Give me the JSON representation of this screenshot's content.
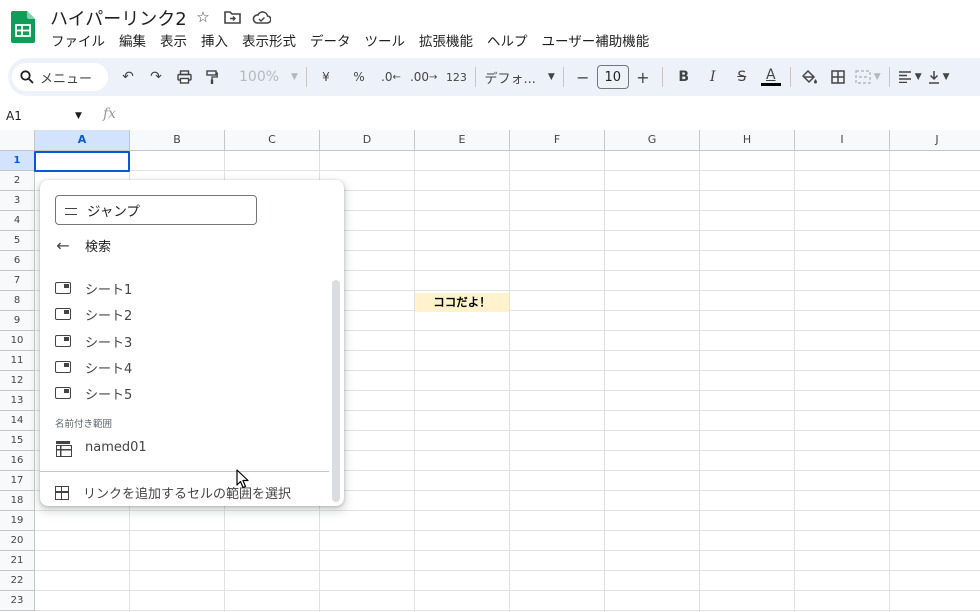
{
  "app": {
    "title": "ハイパーリンク2",
    "brand_color": "#0f9d58"
  },
  "menu": [
    "ファイル",
    "編集",
    "表示",
    "挿入",
    "表示形式",
    "データ",
    "ツール",
    "拡張機能",
    "ヘルプ",
    "ユーザー補助機能"
  ],
  "toolbar": {
    "menu_search": "メニュー",
    "zoom": "100%",
    "currency": "¥",
    "percent": "%",
    "dec_decrease": ".0",
    "dec_increase": ".00",
    "number_format": "123",
    "font": "デフォ...",
    "font_size": "10",
    "minus": "−",
    "plus": "+",
    "bold": "B",
    "italic": "I",
    "strike": "S",
    "text_color": "A"
  },
  "formula_bar": {
    "cell_ref": "A1",
    "fx": "fx"
  },
  "grid": {
    "columns": [
      "A",
      "B",
      "C",
      "D",
      "E",
      "F",
      "G",
      "H",
      "I",
      "J"
    ],
    "rows": [
      "1",
      "2",
      "3",
      "4",
      "5",
      "6",
      "7",
      "8",
      "9",
      "10",
      "11",
      "12",
      "13",
      "14",
      "15",
      "16",
      "17",
      "18",
      "19",
      "20",
      "21",
      "22",
      "23"
    ],
    "selected_cell": "A1",
    "highlight_cell": {
      "ref": "E8",
      "text": "ココだよ！",
      "background": "#fff2cc"
    }
  },
  "link_popup": {
    "jump_input": "ジャンプ",
    "back_label": "検索",
    "sheets": [
      "シート1",
      "シート2",
      "シート3",
      "シート4",
      "シート5"
    ],
    "named_ranges_label": "名前付き範囲",
    "named_ranges": [
      "named01"
    ],
    "select_range_label": "リンクを追加するセルの範囲を選択"
  }
}
